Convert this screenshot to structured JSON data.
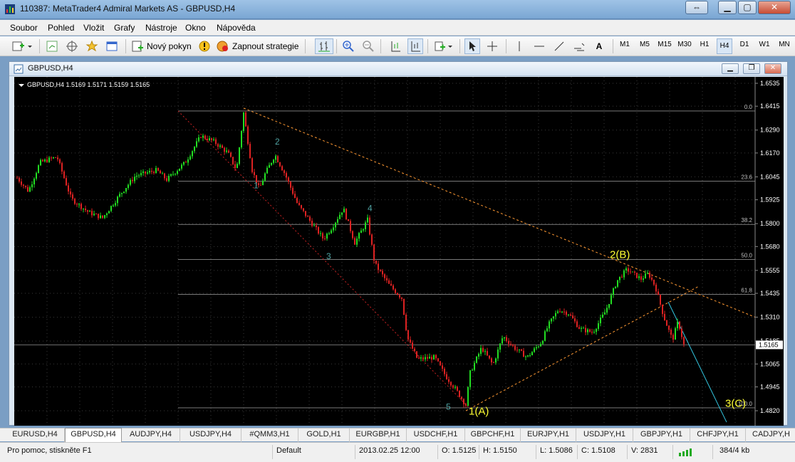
{
  "window": {
    "title": "110387: MetaTrader4 Admiral Markets AS - GBPUSD,H4"
  },
  "menu": [
    "Soubor",
    "Pohled",
    "Vložit",
    "Grafy",
    "Nástroje",
    "Okno",
    "Nápověda"
  ],
  "toolbar": {
    "new_order": "Nový pokyn",
    "autotrading": "Zapnout strategie",
    "text_tool": "A",
    "timeframes": [
      "M1",
      "M5",
      "M15",
      "M30",
      "H1",
      "H4",
      "D1",
      "W1",
      "MN"
    ],
    "active_timeframe": "H4"
  },
  "chart_window": {
    "title": "GBPUSD,H4"
  },
  "chart": {
    "info": "GBPUSD,H4  1.5169 1.5171 1.5159 1.5165",
    "price_scale": [
      "1.6535",
      "1.6415",
      "1.6290",
      "1.6170",
      "1.6045",
      "1.5925",
      "1.5800",
      "1.5680",
      "1.5555",
      "1.5435",
      "1.5310",
      "1.5185",
      "1.5065",
      "1.4945",
      "1.4820"
    ],
    "current_price": "1.5165",
    "fib_levels": [
      "0.0",
      "23.6",
      "38.2",
      "50.0",
      "61.8",
      "100.0"
    ],
    "wave_labels": [
      "1",
      "2",
      "3",
      "4",
      "5"
    ],
    "major_labels": [
      "1(A)",
      "2(B)",
      "3(C)"
    ],
    "colors": {
      "background": "#000000",
      "bull": "#22dd22",
      "bear": "#dd2222",
      "grid": "#3a3a3a",
      "fib": "#c0c0c0",
      "trend": "#ff9933",
      "wave_minor": "#4fa3a3",
      "wave_major": "#ffff33",
      "projection": "#33c6e0"
    }
  },
  "tabs": [
    "EURUSD,H4",
    "GBPUSD,H4",
    "AUDJPY,H4",
    "USDJPY,H4",
    "#QMM3,H1",
    "GOLD,H1",
    "EURGBP,H1",
    "USDCHF,H1",
    "GBPCHF,H1",
    "EURJPY,H1",
    "USDJPY,H1",
    "GBPJPY,H1",
    "CHFJPY,H1",
    "CADJPY,H"
  ],
  "active_tab": "GBPUSD,H4",
  "status": {
    "help": "Pro pomoc, stiskněte F1",
    "profile": "Default",
    "datetime": "2013.02.25 12:00",
    "open": "O: 1.5125",
    "high": "H: 1.5150",
    "low": "L: 1.5086",
    "close": "C: 1.5108",
    "volume": "V: 2831",
    "traffic": "384/4 kb"
  }
}
